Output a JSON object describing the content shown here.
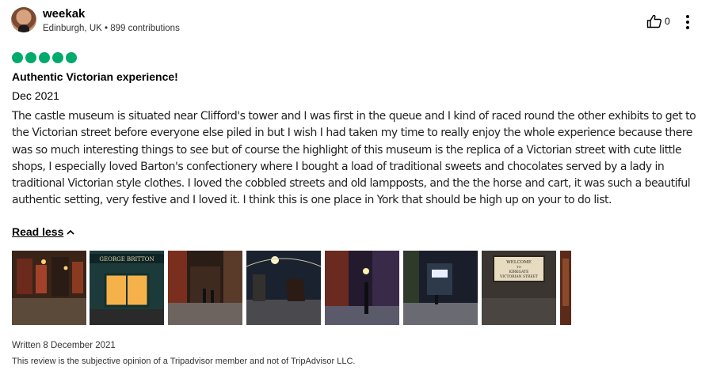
{
  "user": {
    "name": "weekak",
    "location": "Edinburgh, UK",
    "separator": "•",
    "contributions": "899 contributions"
  },
  "helpful": {
    "count": "0",
    "icon": "thumbs-up-icon"
  },
  "menu": {
    "icon": "more-vertical-icon"
  },
  "rating": {
    "bubbles": 5,
    "max": 5,
    "color": "#00aa6c"
  },
  "review": {
    "title": "Authentic Victorian experience!",
    "date": "Dec 2021",
    "text": "The castle museum is situated near Clifford's tower and I was first in the queue and I kind of raced round the other exhibits to get to the Victorian street before everyone else piled in but I wish I had taken my time to really enjoy the whole experience because there was so much interesting things to see but of course the highlight of this museum is the replica of a Victorian street with cute little shops, I especially loved Barton's confectionery where I bought a load of traditional sweets and chocolates served by a lady in traditional Victorian style clothes. I loved the cobbled streets and old lampposts, and the the horse and cart, it was such a beautiful authentic setting, very festive and I loved it. I think this is one place in York that should be high up on your to do list.",
    "read_less": "Read less"
  },
  "photos": [
    {
      "name": "photo-1"
    },
    {
      "name": "photo-2",
      "sign": "GEORGE BRITTON"
    },
    {
      "name": "photo-3"
    },
    {
      "name": "photo-4"
    },
    {
      "name": "photo-5"
    },
    {
      "name": "photo-6"
    },
    {
      "name": "photo-7"
    },
    {
      "name": "photo-8",
      "sign_lines": [
        "WELCOME",
        "TO",
        "KIRKGATE",
        "VICTORIAN STREET"
      ]
    },
    {
      "name": "photo-9-partial"
    }
  ],
  "footer": {
    "written": "Written 8 December 2021",
    "disclaimer": "This review is the subjective opinion of a Tripadvisor member and not of TripAdvisor LLC."
  }
}
